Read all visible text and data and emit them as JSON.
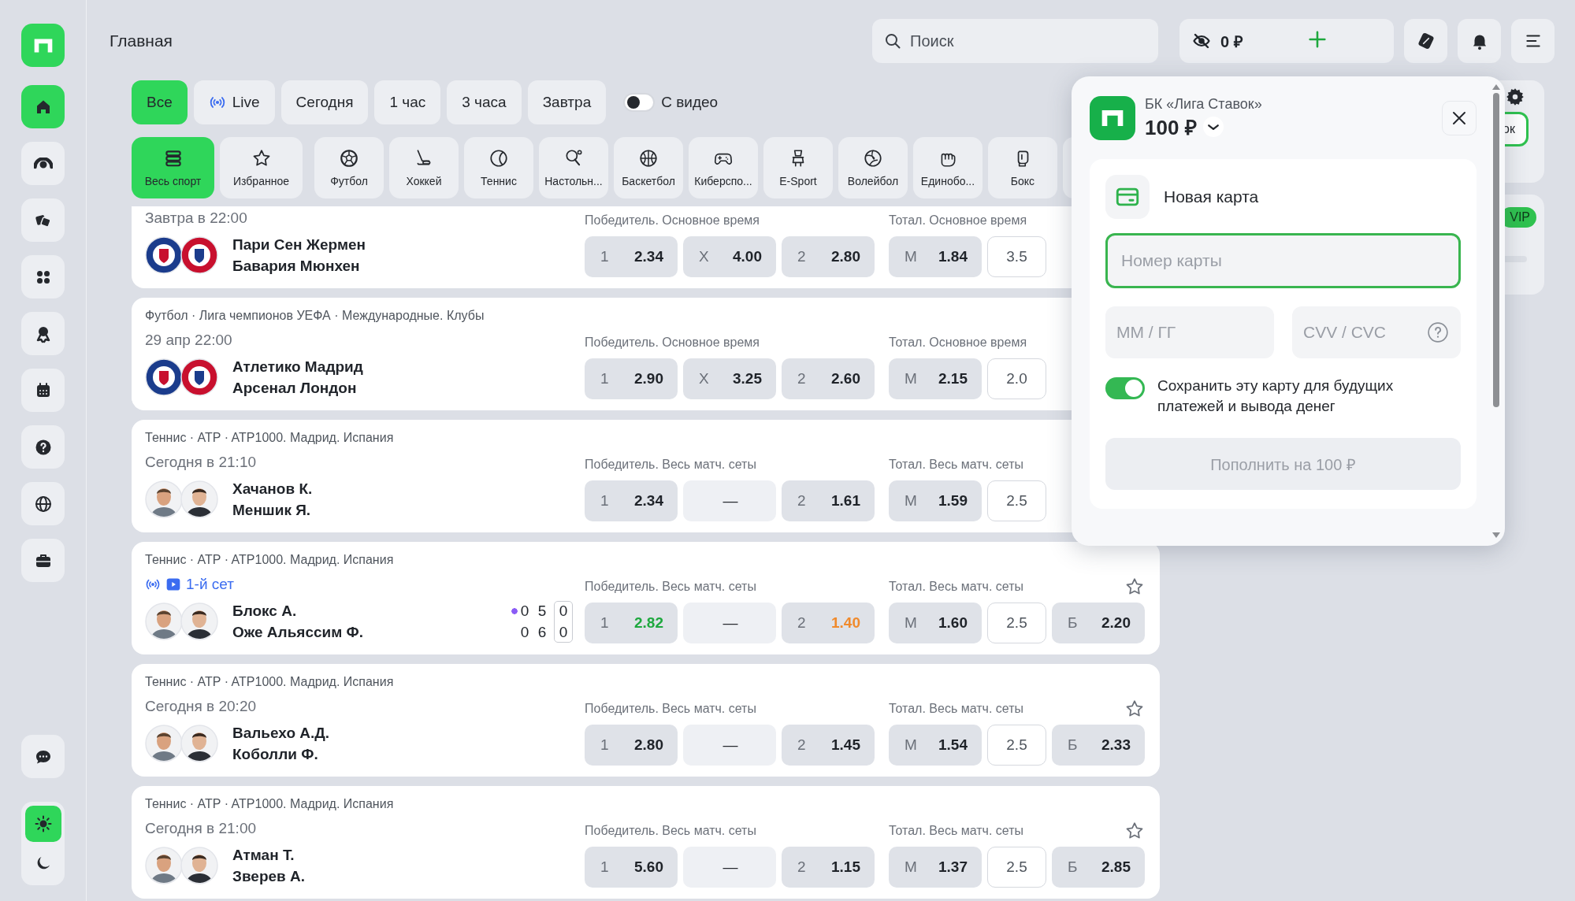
{
  "sidebar": {
    "items": [
      {
        "selected": true
      },
      {
        "selected": false
      },
      {
        "selected": false
      },
      {
        "selected": false
      },
      {
        "selected": false
      },
      {
        "selected": false
      },
      {
        "selected": false
      },
      {
        "selected": false
      },
      {
        "selected": false
      }
    ],
    "theme_switch": [
      {
        "selected": true
      },
      {
        "selected": false
      }
    ]
  },
  "header": {
    "title": "Главная",
    "search": {
      "placeholder": "Поиск"
    },
    "balance": "0 ₽"
  },
  "filters": {
    "chips": [
      {
        "label": "Все",
        "selected": true,
        "kind": "plain"
      },
      {
        "label": "Live",
        "selected": false,
        "kind": "live"
      },
      {
        "label": "Сегодня",
        "selected": false,
        "kind": "plain"
      },
      {
        "label": "1 час",
        "selected": false,
        "kind": "plain"
      },
      {
        "label": "3 часа",
        "selected": false,
        "kind": "plain"
      },
      {
        "label": "Завтра",
        "selected": false,
        "kind": "plain"
      }
    ],
    "video_toggle": {
      "label": "С видео",
      "on": false
    }
  },
  "sports": [
    {
      "label": "Весь спорт",
      "selected": true
    },
    {
      "label": "Избранное",
      "selected": false
    },
    {
      "label": "Футбол",
      "selected": false
    },
    {
      "label": "Хоккей",
      "selected": false
    },
    {
      "label": "Теннис",
      "selected": false
    },
    {
      "label": "Настольн...",
      "selected": false
    },
    {
      "label": "Баскетбол",
      "selected": false
    },
    {
      "label": "Киберспо...",
      "selected": false
    },
    {
      "label": "E-Sport",
      "selected": false
    },
    {
      "label": "Волейбол",
      "selected": false
    },
    {
      "label": "Единобо...",
      "selected": false
    },
    {
      "label": "Бокс",
      "selected": false
    },
    {
      "selected": false
    }
  ],
  "matches": [
    {
      "kind": "team",
      "time": "Завтра в 22:00",
      "teams": [
        "Пари Сен Жермен",
        "Бавария Мюнхен"
      ],
      "markets": [
        {
          "title": "Победитель. Основное время",
          "odds": [
            {
              "kind": "odd",
              "label": "1",
              "value": "2.34"
            },
            {
              "kind": "odd",
              "label": "X",
              "value": "4.00"
            },
            {
              "kind": "odd",
              "label": "2",
              "value": "2.80"
            }
          ]
        },
        {
          "title": "Тотал. Основное время",
          "odds": [
            {
              "kind": "odd",
              "label": "М",
              "value": "1.84"
            },
            {
              "kind": "line",
              "value": "3.5"
            }
          ]
        }
      ]
    },
    {
      "kind": "team",
      "league": "Футбол · Лига чемпионов УЕФА · Международные. Клубы",
      "time": "29 апр 22:00",
      "teams": [
        "Атлетико Мадрид",
        "Арсенал Лондон"
      ],
      "markets": [
        {
          "title": "Победитель. Основное время",
          "odds": [
            {
              "kind": "odd",
              "label": "1",
              "value": "2.90"
            },
            {
              "kind": "odd",
              "label": "X",
              "value": "3.25"
            },
            {
              "kind": "odd",
              "label": "2",
              "value": "2.60"
            }
          ]
        },
        {
          "title": "Тотал. Основное время",
          "odds": [
            {
              "kind": "odd",
              "label": "М",
              "value": "2.15"
            },
            {
              "kind": "line",
              "value": "2.0"
            }
          ]
        }
      ]
    },
    {
      "kind": "player",
      "league": "Теннис · ATP · ATP1000. Мадрид. Испания",
      "time": "Сегодня в 21:10",
      "teams": [
        "Хачанов К.",
        "Меншик Я."
      ],
      "markets": [
        {
          "title": "Победитель. Весь матч. сеты",
          "odds": [
            {
              "kind": "odd",
              "label": "1",
              "value": "2.34"
            },
            {
              "kind": "dash",
              "label": "—"
            },
            {
              "kind": "odd",
              "label": "2",
              "value": "1.61"
            }
          ]
        },
        {
          "title": "Тотал. Весь матч. сеты",
          "odds": [
            {
              "kind": "odd",
              "label": "М",
              "value": "1.59"
            },
            {
              "kind": "line",
              "value": "2.5"
            }
          ]
        }
      ]
    },
    {
      "kind": "player",
      "league": "Теннис · ATP · ATP1000. Мадрид. Испания",
      "live": {
        "period": "1-й сет"
      },
      "teams": [
        "Блокс А.",
        "Оже Альяссим Ф."
      ],
      "score": {
        "serving": [
          true,
          false
        ],
        "columns": [
          [
            "0",
            "0"
          ],
          [
            "5",
            "6"
          ],
          [
            "0",
            "0"
          ]
        ]
      },
      "favorite_icon": true,
      "markets": [
        {
          "title": "Победитель. Весь матч. сеты",
          "odds": [
            {
              "kind": "odd",
              "label": "1",
              "value": "2.82",
              "rising": true
            },
            {
              "kind": "dash",
              "label": "—"
            },
            {
              "kind": "odd",
              "label": "2",
              "value": "1.40",
              "falling": true
            }
          ]
        },
        {
          "title": "Тотал. Весь матч. сеты",
          "odds": [
            {
              "kind": "odd",
              "label": "М",
              "value": "1.60"
            },
            {
              "kind": "line",
              "value": "2.5"
            },
            {
              "kind": "odd",
              "label": "Б",
              "value": "2.20"
            }
          ]
        }
      ]
    },
    {
      "kind": "player",
      "league": "Теннис · ATP · ATP1000. Мадрид. Испания",
      "time": "Сегодня в 20:20",
      "teams": [
        "Вальехо А.Д.",
        "Коболли Ф."
      ],
      "favorite_icon": true,
      "markets": [
        {
          "title": "Победитель. Весь матч. сеты",
          "odds": [
            {
              "kind": "odd",
              "label": "1",
              "value": "2.80"
            },
            {
              "kind": "dash",
              "label": "—"
            },
            {
              "kind": "odd",
              "label": "2",
              "value": "1.45"
            }
          ]
        },
        {
          "title": "Тотал. Весь матч. сеты",
          "odds": [
            {
              "kind": "odd",
              "label": "М",
              "value": "1.54"
            },
            {
              "kind": "line",
              "value": "2.5"
            },
            {
              "kind": "odd",
              "label": "Б",
              "value": "2.33"
            }
          ]
        }
      ]
    },
    {
      "kind": "player",
      "league": "Теннис · ATP · ATP1000. Мадрид. Испания",
      "time": "Сегодня в 21:00",
      "teams": [
        "Атман Т.",
        "Зверев А."
      ],
      "favorite_icon": true,
      "markets": [
        {
          "title": "Победитель. Весь матч. сеты",
          "odds": [
            {
              "kind": "odd",
              "label": "1",
              "value": "5.60"
            },
            {
              "kind": "dash",
              "label": "—"
            },
            {
              "kind": "odd",
              "label": "2",
              "value": "1.15"
            }
          ]
        },
        {
          "title": "Тотал. Весь матч. сеты",
          "odds": [
            {
              "kind": "odd",
              "label": "М",
              "value": "1.37"
            },
            {
              "kind": "line",
              "value": "2.5"
            },
            {
              "kind": "odd",
              "label": "Б",
              "value": "2.85"
            }
          ]
        }
      ]
    }
  ],
  "right_panel": {
    "button": "ок",
    "badge": "VIP"
  },
  "popup": {
    "brand": "БК «Лига Ставок»",
    "amount": "100 ₽",
    "section_title": "Новая карта",
    "card_number": {
      "placeholder": "Номер карты"
    },
    "expiry": {
      "placeholder": "ММ / ГГ"
    },
    "cvv": {
      "placeholder": "CVV / CVC"
    },
    "save_card": {
      "label": "Сохранить эту карту для будущих платежей и вывода денег",
      "on": true
    },
    "submit": {
      "label": "Пополнить на 100 ₽",
      "disabled": true
    }
  }
}
